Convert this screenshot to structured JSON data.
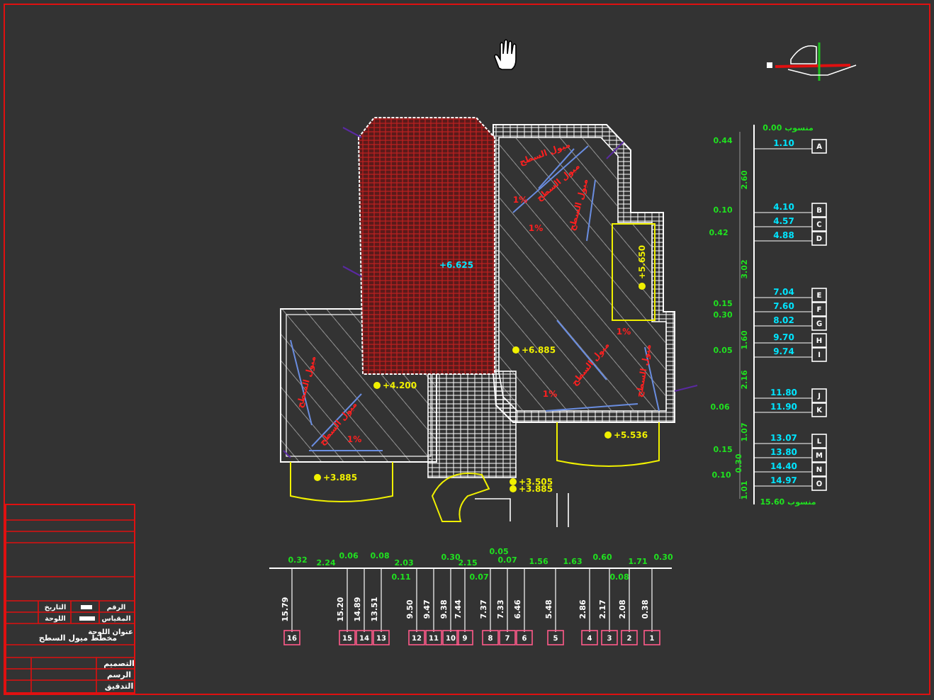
{
  "plan": {
    "roof_level": "+6.625",
    "elevations": [
      {
        "text": "+6.885"
      },
      {
        "text": "+4.200"
      },
      {
        "text": "+5.650"
      },
      {
        "text": "+5.536"
      },
      {
        "text": "+3.885"
      },
      {
        "text": "+3.505"
      },
      {
        "text": "+3.885"
      }
    ],
    "slope_labels": [
      {
        "text": "ميول السطح"
      },
      {
        "text": "1%"
      },
      {
        "text": "ميول السطح"
      },
      {
        "text": "1%"
      },
      {
        "text": "ميول السطح"
      },
      {
        "text": "ميول السطح"
      },
      {
        "text": "1%"
      },
      {
        "text": "ميول السطح"
      },
      {
        "text": "1%"
      },
      {
        "text": "ميول السطح"
      },
      {
        "text": "ميول السطح"
      },
      {
        "text": "1%"
      }
    ]
  },
  "side_profile": {
    "start": "منسوب 0.00",
    "end": "منسوب 15.60",
    "dims": [
      "0.44",
      "2.60",
      "0.10",
      "0.42",
      "3.02",
      "0.15",
      "0.30",
      "1.60",
      "0.05",
      "2.16",
      "0.06",
      "1.07",
      "0.15",
      "0.30",
      "0.10",
      "1.01"
    ],
    "points": [
      {
        "letter": "A",
        "level": "1.10"
      },
      {
        "letter": "B",
        "level": "4.10"
      },
      {
        "letter": "C",
        "level": "4.57"
      },
      {
        "letter": "D",
        "level": "4.88"
      },
      {
        "letter": "E",
        "level": "7.04"
      },
      {
        "letter": "F",
        "level": "7.60"
      },
      {
        "letter": "G",
        "level": "8.02"
      },
      {
        "letter": "H",
        "level": "9.70"
      },
      {
        "letter": "I",
        "level": "9.74"
      },
      {
        "letter": "J",
        "level": "11.80"
      },
      {
        "letter": "K",
        "level": "11.90"
      },
      {
        "letter": "L",
        "level": "13.07"
      },
      {
        "letter": "M",
        "level": "13.80"
      },
      {
        "letter": "N",
        "level": "14.40"
      },
      {
        "letter": "O",
        "level": "14.97"
      }
    ]
  },
  "section_profile": {
    "dims": [
      "0.32",
      "2.24",
      "0.06",
      "0.08",
      "2.03",
      "0.11",
      "0.30",
      "2.15",
      "0.05",
      "0.07",
      "0.07",
      "1.56",
      "1.63",
      "0.60",
      "0.08",
      "1.71",
      "0.30"
    ],
    "stations": [
      {
        "number": "16",
        "level": "15.79"
      },
      {
        "number": "15",
        "level": "15.20"
      },
      {
        "number": "14",
        "level": "14.89"
      },
      {
        "number": "13",
        "level": "13.51"
      },
      {
        "number": "12",
        "level": "9.50"
      },
      {
        "number": "11",
        "level": "9.47"
      },
      {
        "number": "10",
        "level": "9.38"
      },
      {
        "number": "9",
        "level": "7.44"
      },
      {
        "number": "8",
        "level": "7.37"
      },
      {
        "number": "7",
        "level": "7.33"
      },
      {
        "number": "6",
        "level": "6.46"
      },
      {
        "number": "5",
        "level": "5.48"
      },
      {
        "number": "4",
        "level": "2.86"
      },
      {
        "number": "3",
        "level": "2.17"
      },
      {
        "number": "2",
        "level": "2.08"
      },
      {
        "number": "1",
        "level": "0.38"
      }
    ]
  },
  "title_block": {
    "fields": [
      {
        "label": "التاريخ"
      },
      {
        "label": "الرقم"
      },
      {
        "label": "اللوحة"
      },
      {
        "label": "المقياس"
      }
    ],
    "sheet_title_label": "عنوان اللوحة",
    "sheet_title": "مخطط ميول السطح",
    "signatures": [
      "التصميم",
      "الرسم",
      "التدقيق"
    ]
  }
}
